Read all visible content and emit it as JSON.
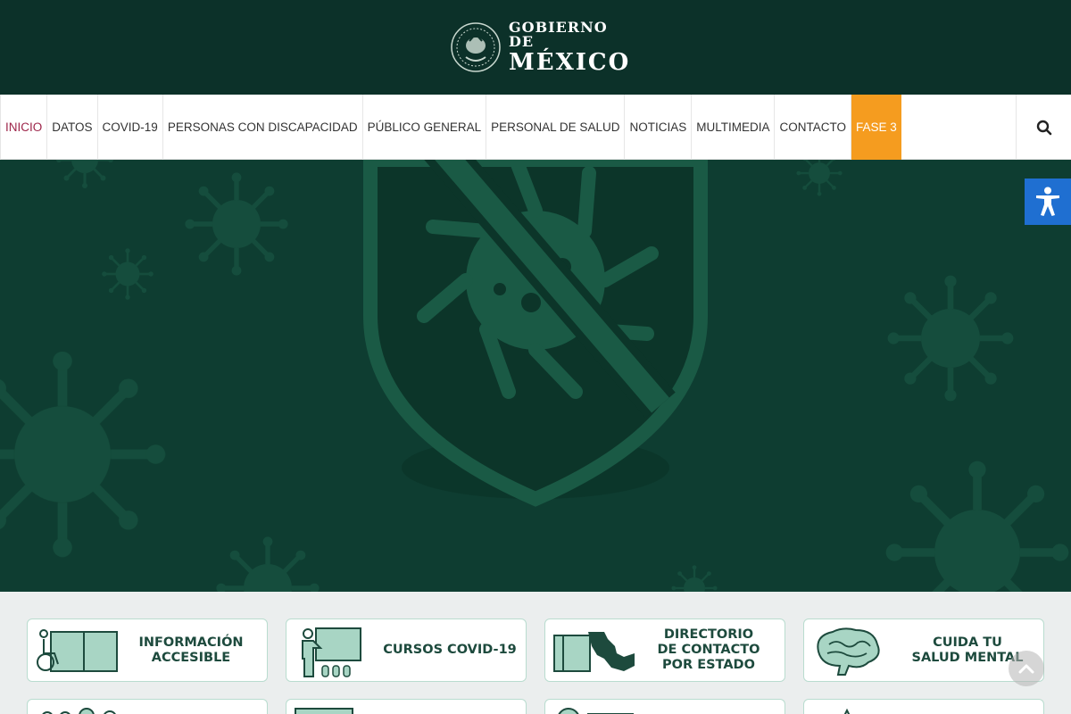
{
  "header": {
    "logo_line1": "GOBIERNO DE",
    "logo_line2": "MÉXICO",
    "background": "#0c3129"
  },
  "nav": {
    "items": [
      {
        "label": "INICIO",
        "state": "active"
      },
      {
        "label": "DATOS",
        "state": "normal"
      },
      {
        "label": "COVID-19",
        "state": "normal"
      },
      {
        "label": "PERSONAS CON DISCAPACIDAD",
        "state": "normal"
      },
      {
        "label": "PÚBLICO GENERAL",
        "state": "normal"
      },
      {
        "label": "PERSONAL DE SALUD",
        "state": "normal"
      },
      {
        "label": "NOTICIAS",
        "state": "normal"
      },
      {
        "label": "MULTIMEDIA",
        "state": "normal"
      },
      {
        "label": "CONTACTO",
        "state": "normal"
      },
      {
        "label": "FASE 3",
        "state": "highlight"
      }
    ],
    "search_icon": "search-icon",
    "active_color": "#9d2449",
    "highlight_color": "#f59c1f"
  },
  "hero": {
    "background": "#0e3d31",
    "icon": "virus-shield-icon"
  },
  "accessibility": {
    "icon": "accessibility-icon",
    "color": "#1f6fd1"
  },
  "quick_links": {
    "row1": [
      {
        "label": "INFORMACIÓN\nACCESIBLE",
        "icon": "wheelchair-book-icon"
      },
      {
        "label": "CURSOS COVID-19",
        "icon": "teacher-board-icon"
      },
      {
        "label": "DIRECTORIO\nDE CONTACTO\nPOR ESTADO",
        "icon": "map-directory-icon"
      },
      {
        "label": "CUIDA TU\nSALUD MENTAL",
        "icon": "brain-icon"
      }
    ]
  },
  "back_to_top_icon": "chevron-up-icon"
}
